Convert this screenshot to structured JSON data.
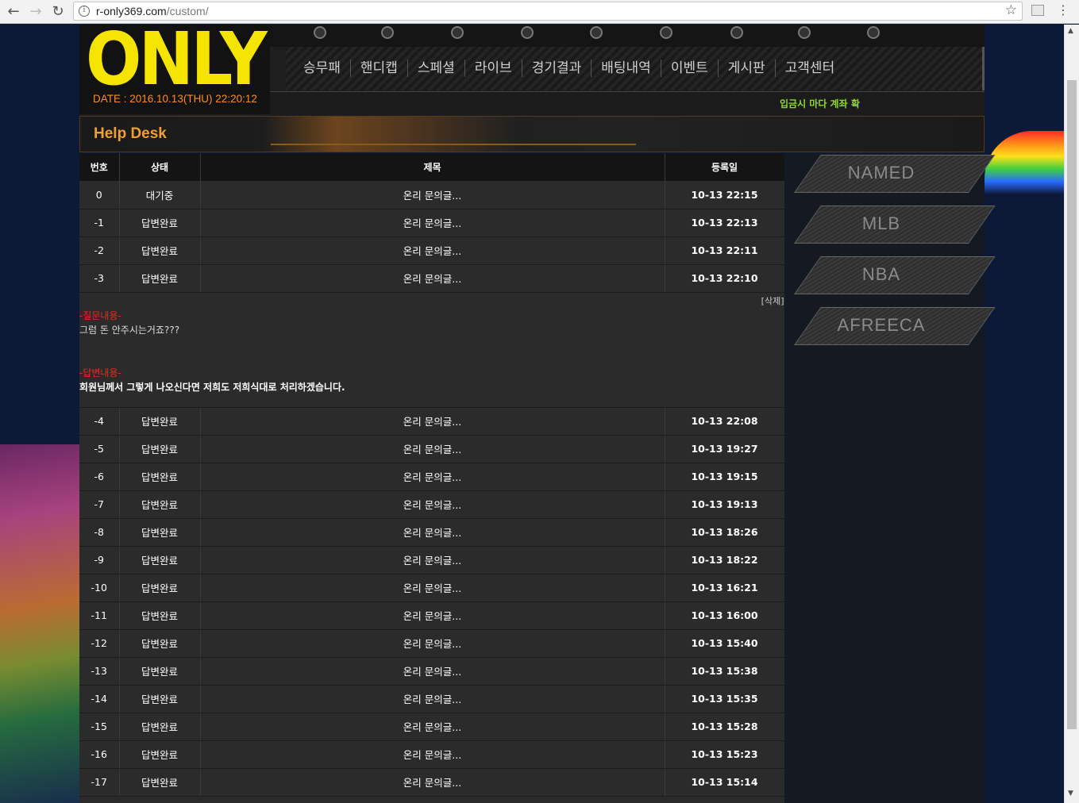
{
  "browser": {
    "url_host": "r-only369.com",
    "url_path": "/custom/"
  },
  "site": {
    "logo": "ONLY",
    "date": "DATE : 2016.10.13(THU) 22:20:12",
    "menu": [
      "승무패",
      "핸디캡",
      "스페셜",
      "라이브",
      "경기결과",
      "배팅내역",
      "이벤트",
      "게시판",
      "고객센터"
    ],
    "ticker": "입금시 마다 계좌 확"
  },
  "helpdesk": {
    "title": "Help Desk"
  },
  "table": {
    "headers": [
      "번호",
      "상태",
      "제목",
      "등록일"
    ],
    "rows_top": [
      {
        "num": "0",
        "status": "대기중",
        "title": "온리 문의글...",
        "date": "10-13 22:15"
      },
      {
        "num": "-1",
        "status": "답변완료",
        "title": "온리 문의글...",
        "date": "10-13 22:13"
      },
      {
        "num": "-2",
        "status": "답변완료",
        "title": "온리 문의글...",
        "date": "10-13 22:11"
      },
      {
        "num": "-3",
        "status": "답변완료",
        "title": "온리 문의글...",
        "date": "10-13 22:10"
      }
    ],
    "detail": {
      "delete": "[삭제]",
      "question_label": "-질문내용-",
      "question": "그럼 돈 안주시는거죠???",
      "answer_label": "-답변내용-",
      "answer": "회원님께서 그렇게 나오신다면 저희도 저희식대로 처리하겠습니다."
    },
    "rows_bottom": [
      {
        "num": "-4",
        "status": "답변완료",
        "title": "온리 문의글...",
        "date": "10-13 22:08"
      },
      {
        "num": "-5",
        "status": "답변완료",
        "title": "온리 문의글...",
        "date": "10-13 19:27"
      },
      {
        "num": "-6",
        "status": "답변완료",
        "title": "온리 문의글...",
        "date": "10-13 19:15"
      },
      {
        "num": "-7",
        "status": "답변완료",
        "title": "온리 문의글...",
        "date": "10-13 19:13"
      },
      {
        "num": "-8",
        "status": "답변완료",
        "title": "온리 문의글...",
        "date": "10-13 18:26"
      },
      {
        "num": "-9",
        "status": "답변완료",
        "title": "온리 문의글...",
        "date": "10-13 18:22"
      },
      {
        "num": "-10",
        "status": "답변완료",
        "title": "온리 문의글...",
        "date": "10-13 16:21"
      },
      {
        "num": "-11",
        "status": "답변완료",
        "title": "온리 문의글...",
        "date": "10-13 16:00"
      },
      {
        "num": "-12",
        "status": "답변완료",
        "title": "온리 문의글...",
        "date": "10-13 15:40"
      },
      {
        "num": "-13",
        "status": "답변완료",
        "title": "온리 문의글...",
        "date": "10-13 15:38"
      },
      {
        "num": "-14",
        "status": "답변완료",
        "title": "온리 문의글...",
        "date": "10-13 15:35"
      },
      {
        "num": "-15",
        "status": "답변완료",
        "title": "온리 문의글...",
        "date": "10-13 15:28"
      },
      {
        "num": "-16",
        "status": "답변완료",
        "title": "온리 문의글...",
        "date": "10-13 15:23"
      },
      {
        "num": "-17",
        "status": "답변완료",
        "title": "온리 문의글...",
        "date": "10-13 15:14"
      }
    ]
  },
  "side": [
    "NAMED",
    "MLB",
    "NBA",
    "AFREECA"
  ],
  "colors": {
    "logo": "#f5e400",
    "date": "#ff8c1a",
    "helpdesk_title": "#f0a030",
    "ticker": "#8fd92e",
    "label_red": "#ff2020"
  }
}
